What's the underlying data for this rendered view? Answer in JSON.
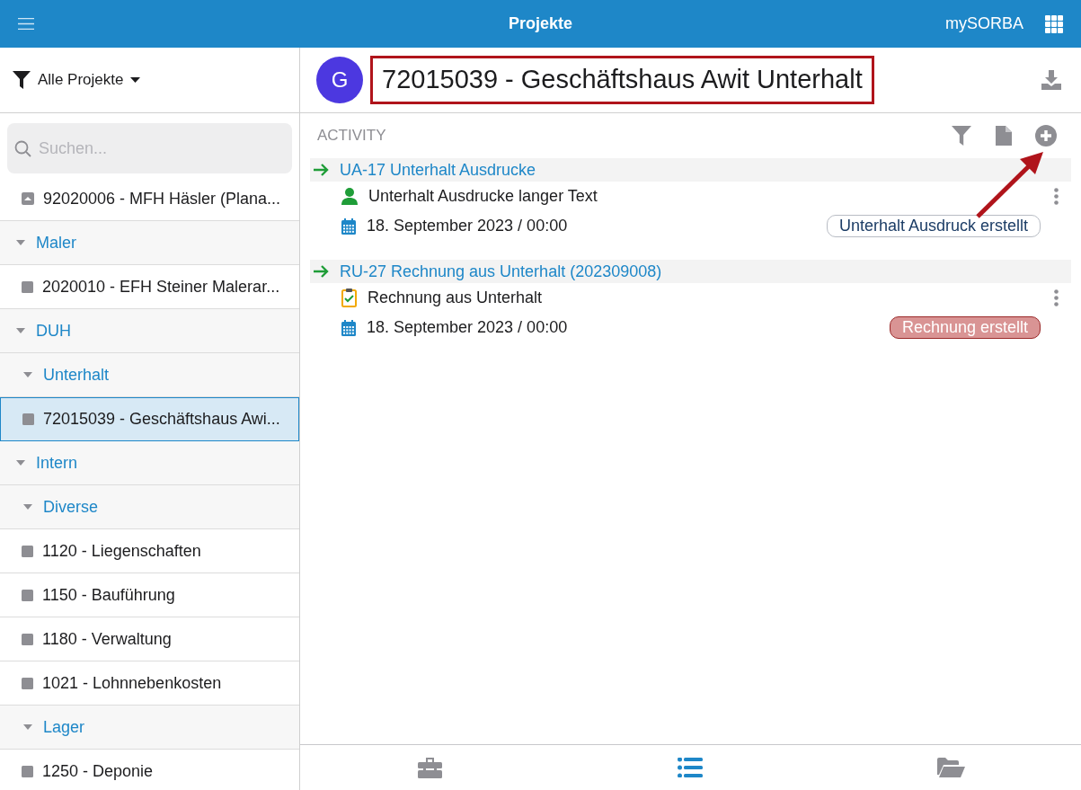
{
  "topbar": {
    "title": "Projekte",
    "account": "mySORBA"
  },
  "sidebar": {
    "filter": "Alle Projekte",
    "search": {
      "placeholder": "Suchen..."
    },
    "tree": [
      {
        "kind": "archived",
        "label": "92020006 - MFH Häsler (Plana...",
        "selected": false
      },
      {
        "kind": "group",
        "label": "Maler",
        "expanded": true,
        "children": [
          {
            "kind": "project",
            "label": "2020010 - EFH Steiner Malerar...",
            "selected": false
          }
        ]
      },
      {
        "kind": "group",
        "label": "DUH",
        "expanded": true,
        "children": [
          {
            "kind": "group",
            "label": "Unterhalt",
            "expanded": true,
            "children": [
              {
                "kind": "project",
                "label": "72015039 - Geschäftshaus Awi...",
                "selected": true
              }
            ]
          }
        ]
      },
      {
        "kind": "group",
        "label": "Intern",
        "expanded": true,
        "children": [
          {
            "kind": "group",
            "label": "Diverse",
            "expanded": true,
            "children": [
              {
                "kind": "project",
                "label": "1120 - Liegenschaften",
                "selected": false
              },
              {
                "kind": "project",
                "label": "1150 - Bauführung",
                "selected": false
              },
              {
                "kind": "project",
                "label": "1180 - Verwaltung",
                "selected": false
              },
              {
                "kind": "project",
                "label": "1021 - Lohnnebenkosten",
                "selected": false
              }
            ]
          },
          {
            "kind": "group",
            "label": "Lager",
            "expanded": true,
            "children": [
              {
                "kind": "project",
                "label": "1250 - Deponie",
                "selected": false
              }
            ]
          }
        ]
      }
    ]
  },
  "project": {
    "avatar": "G",
    "title": "72015039 - Geschäftshaus Awit Unterhalt",
    "highlighted": true
  },
  "activity": {
    "heading": "ACTIVITY",
    "arrow_annotation": true,
    "items": [
      {
        "title": "UA-17 Unterhalt Ausdrucke",
        "kind": "person",
        "text": "Unterhalt Ausdrucke langer Text",
        "date": "18. September 2023 / 00:00",
        "status": {
          "label": "Unterhalt Ausdruck erstellt",
          "kind": "outline"
        }
      },
      {
        "title": "RU-27 Rechnung aus Unterhalt (202309008)",
        "kind": "checklist",
        "text": "Rechnung aus Unterhalt",
        "date": "18. September 2023 / 00:00",
        "status": {
          "label": "Rechnung erstellt",
          "kind": "filled"
        }
      }
    ]
  },
  "bottom_tabs": [
    {
      "kind": "toolbox",
      "selected": false
    },
    {
      "kind": "list",
      "selected": true
    },
    {
      "kind": "folder",
      "selected": false
    }
  ]
}
